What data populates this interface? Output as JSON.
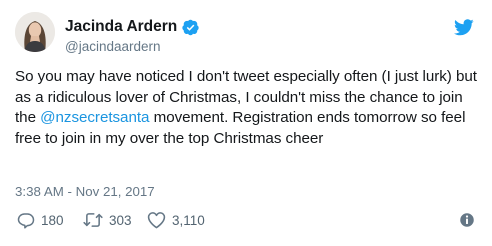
{
  "user": {
    "name": "Jacinda Ardern",
    "handle": "@jacindaardern",
    "verified": true,
    "avatar_icon": "profile-photo"
  },
  "tweet": {
    "text_before": "So you may have noticed I don't tweet especially often (I just lurk) but as a ridiculous lover of Christmas, I couldn't miss the chance to join the ",
    "mention": "@nzsecretsanta",
    "text_after": " movement. Registration ends tomorrow so feel free to join in my over the top Christmas cheer",
    "timestamp": "3:38 AM - Nov 21, 2017"
  },
  "actions": {
    "replies": "180",
    "retweets": "303",
    "likes": "3,110"
  },
  "icons": {
    "brand": "twitter-bird-icon",
    "verified": "verified-badge-icon",
    "reply": "reply-icon",
    "retweet": "retweet-icon",
    "like": "heart-icon",
    "info": "info-icon"
  },
  "colors": {
    "brand_blue": "#1da1f2",
    "link_blue": "#1b95e0",
    "muted_gray": "#657786",
    "text": "#14171a"
  }
}
